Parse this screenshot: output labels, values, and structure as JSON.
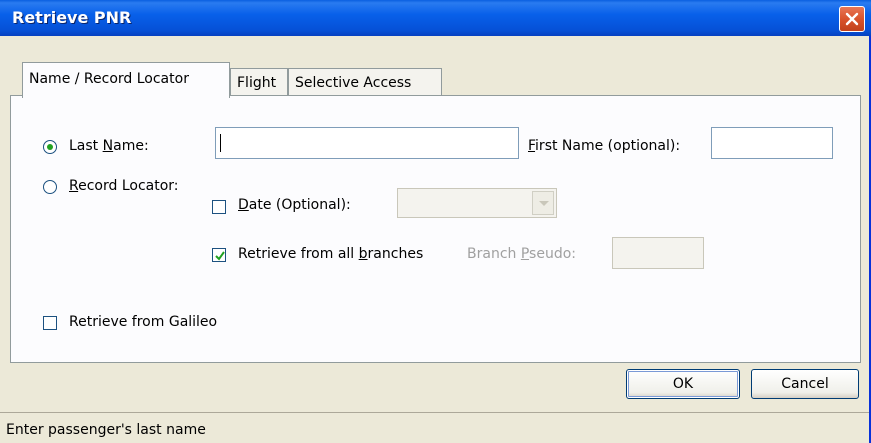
{
  "window": {
    "title": "Retrieve PNR"
  },
  "tabs": [
    {
      "label": "Name / Record Locator",
      "active": true
    },
    {
      "label": "Flight",
      "active": false
    },
    {
      "label": "Selective Access",
      "active": false
    }
  ],
  "form": {
    "last_name_label_pre": "Last ",
    "last_name_label_ul": "N",
    "last_name_label_post": "ame:",
    "last_name_value": "",
    "first_name_label_ul": "F",
    "first_name_label_post": "irst Name (optional):",
    "first_name_value": "",
    "record_locator_label_ul": "R",
    "record_locator_label_post": "ecord Locator:",
    "date_label_ul": "D",
    "date_label_post": "ate (Optional):",
    "date_value": "",
    "retrieve_all_pre": "Retrieve from all ",
    "retrieve_all_ul": "b",
    "retrieve_all_post": "ranches",
    "branch_pseudo_pre": "Branch ",
    "branch_pseudo_ul": "P",
    "branch_pseudo_post": "seudo:",
    "branch_pseudo_value": "",
    "retrieve_galileo_label": "Retrieve from Galileo",
    "selected_mode": "last_name",
    "date_checked": false,
    "retrieve_all_checked": true,
    "retrieve_galileo_checked": false
  },
  "buttons": {
    "ok": "OK",
    "cancel": "Cancel"
  },
  "status": {
    "text": "Enter passenger's last name"
  },
  "colors": {
    "titlebar": "#0a5fe0",
    "dialog_bg": "#ece9d8",
    "close": "#d9532c"
  }
}
